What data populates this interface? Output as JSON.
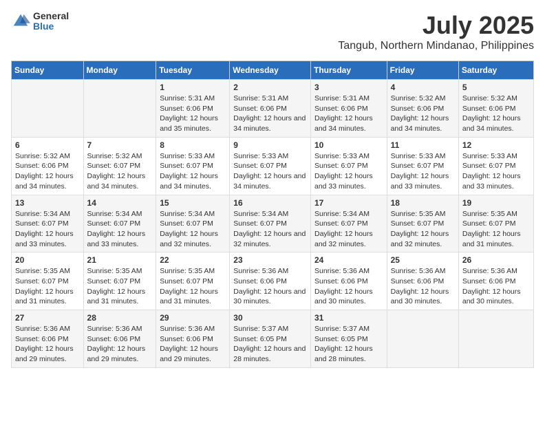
{
  "header": {
    "logo": {
      "general": "General",
      "blue": "Blue"
    },
    "title": "July 2025",
    "subtitle": "Tangub, Northern Mindanao, Philippines"
  },
  "days_of_week": [
    "Sunday",
    "Monday",
    "Tuesday",
    "Wednesday",
    "Thursday",
    "Friday",
    "Saturday"
  ],
  "weeks": [
    [
      {
        "day": "",
        "info": ""
      },
      {
        "day": "",
        "info": ""
      },
      {
        "day": "1",
        "sunrise": "Sunrise: 5:31 AM",
        "sunset": "Sunset: 6:06 PM",
        "daylight": "Daylight: 12 hours and 35 minutes."
      },
      {
        "day": "2",
        "sunrise": "Sunrise: 5:31 AM",
        "sunset": "Sunset: 6:06 PM",
        "daylight": "Daylight: 12 hours and 34 minutes."
      },
      {
        "day": "3",
        "sunrise": "Sunrise: 5:31 AM",
        "sunset": "Sunset: 6:06 PM",
        "daylight": "Daylight: 12 hours and 34 minutes."
      },
      {
        "day": "4",
        "sunrise": "Sunrise: 5:32 AM",
        "sunset": "Sunset: 6:06 PM",
        "daylight": "Daylight: 12 hours and 34 minutes."
      },
      {
        "day": "5",
        "sunrise": "Sunrise: 5:32 AM",
        "sunset": "Sunset: 6:06 PM",
        "daylight": "Daylight: 12 hours and 34 minutes."
      }
    ],
    [
      {
        "day": "6",
        "sunrise": "Sunrise: 5:32 AM",
        "sunset": "Sunset: 6:06 PM",
        "daylight": "Daylight: 12 hours and 34 minutes."
      },
      {
        "day": "7",
        "sunrise": "Sunrise: 5:32 AM",
        "sunset": "Sunset: 6:07 PM",
        "daylight": "Daylight: 12 hours and 34 minutes."
      },
      {
        "day": "8",
        "sunrise": "Sunrise: 5:33 AM",
        "sunset": "Sunset: 6:07 PM",
        "daylight": "Daylight: 12 hours and 34 minutes."
      },
      {
        "day": "9",
        "sunrise": "Sunrise: 5:33 AM",
        "sunset": "Sunset: 6:07 PM",
        "daylight": "Daylight: 12 hours and 34 minutes."
      },
      {
        "day": "10",
        "sunrise": "Sunrise: 5:33 AM",
        "sunset": "Sunset: 6:07 PM",
        "daylight": "Daylight: 12 hours and 33 minutes."
      },
      {
        "day": "11",
        "sunrise": "Sunrise: 5:33 AM",
        "sunset": "Sunset: 6:07 PM",
        "daylight": "Daylight: 12 hours and 33 minutes."
      },
      {
        "day": "12",
        "sunrise": "Sunrise: 5:33 AM",
        "sunset": "Sunset: 6:07 PM",
        "daylight": "Daylight: 12 hours and 33 minutes."
      }
    ],
    [
      {
        "day": "13",
        "sunrise": "Sunrise: 5:34 AM",
        "sunset": "Sunset: 6:07 PM",
        "daylight": "Daylight: 12 hours and 33 minutes."
      },
      {
        "day": "14",
        "sunrise": "Sunrise: 5:34 AM",
        "sunset": "Sunset: 6:07 PM",
        "daylight": "Daylight: 12 hours and 33 minutes."
      },
      {
        "day": "15",
        "sunrise": "Sunrise: 5:34 AM",
        "sunset": "Sunset: 6:07 PM",
        "daylight": "Daylight: 12 hours and 32 minutes."
      },
      {
        "day": "16",
        "sunrise": "Sunrise: 5:34 AM",
        "sunset": "Sunset: 6:07 PM",
        "daylight": "Daylight: 12 hours and 32 minutes."
      },
      {
        "day": "17",
        "sunrise": "Sunrise: 5:34 AM",
        "sunset": "Sunset: 6:07 PM",
        "daylight": "Daylight: 12 hours and 32 minutes."
      },
      {
        "day": "18",
        "sunrise": "Sunrise: 5:35 AM",
        "sunset": "Sunset: 6:07 PM",
        "daylight": "Daylight: 12 hours and 32 minutes."
      },
      {
        "day": "19",
        "sunrise": "Sunrise: 5:35 AM",
        "sunset": "Sunset: 6:07 PM",
        "daylight": "Daylight: 12 hours and 31 minutes."
      }
    ],
    [
      {
        "day": "20",
        "sunrise": "Sunrise: 5:35 AM",
        "sunset": "Sunset: 6:07 PM",
        "daylight": "Daylight: 12 hours and 31 minutes."
      },
      {
        "day": "21",
        "sunrise": "Sunrise: 5:35 AM",
        "sunset": "Sunset: 6:07 PM",
        "daylight": "Daylight: 12 hours and 31 minutes."
      },
      {
        "day": "22",
        "sunrise": "Sunrise: 5:35 AM",
        "sunset": "Sunset: 6:07 PM",
        "daylight": "Daylight: 12 hours and 31 minutes."
      },
      {
        "day": "23",
        "sunrise": "Sunrise: 5:36 AM",
        "sunset": "Sunset: 6:06 PM",
        "daylight": "Daylight: 12 hours and 30 minutes."
      },
      {
        "day": "24",
        "sunrise": "Sunrise: 5:36 AM",
        "sunset": "Sunset: 6:06 PM",
        "daylight": "Daylight: 12 hours and 30 minutes."
      },
      {
        "day": "25",
        "sunrise": "Sunrise: 5:36 AM",
        "sunset": "Sunset: 6:06 PM",
        "daylight": "Daylight: 12 hours and 30 minutes."
      },
      {
        "day": "26",
        "sunrise": "Sunrise: 5:36 AM",
        "sunset": "Sunset: 6:06 PM",
        "daylight": "Daylight: 12 hours and 30 minutes."
      }
    ],
    [
      {
        "day": "27",
        "sunrise": "Sunrise: 5:36 AM",
        "sunset": "Sunset: 6:06 PM",
        "daylight": "Daylight: 12 hours and 29 minutes."
      },
      {
        "day": "28",
        "sunrise": "Sunrise: 5:36 AM",
        "sunset": "Sunset: 6:06 PM",
        "daylight": "Daylight: 12 hours and 29 minutes."
      },
      {
        "day": "29",
        "sunrise": "Sunrise: 5:36 AM",
        "sunset": "Sunset: 6:06 PM",
        "daylight": "Daylight: 12 hours and 29 minutes."
      },
      {
        "day": "30",
        "sunrise": "Sunrise: 5:37 AM",
        "sunset": "Sunset: 6:05 PM",
        "daylight": "Daylight: 12 hours and 28 minutes."
      },
      {
        "day": "31",
        "sunrise": "Sunrise: 5:37 AM",
        "sunset": "Sunset: 6:05 PM",
        "daylight": "Daylight: 12 hours and 28 minutes."
      },
      {
        "day": "",
        "info": ""
      },
      {
        "day": "",
        "info": ""
      }
    ]
  ]
}
